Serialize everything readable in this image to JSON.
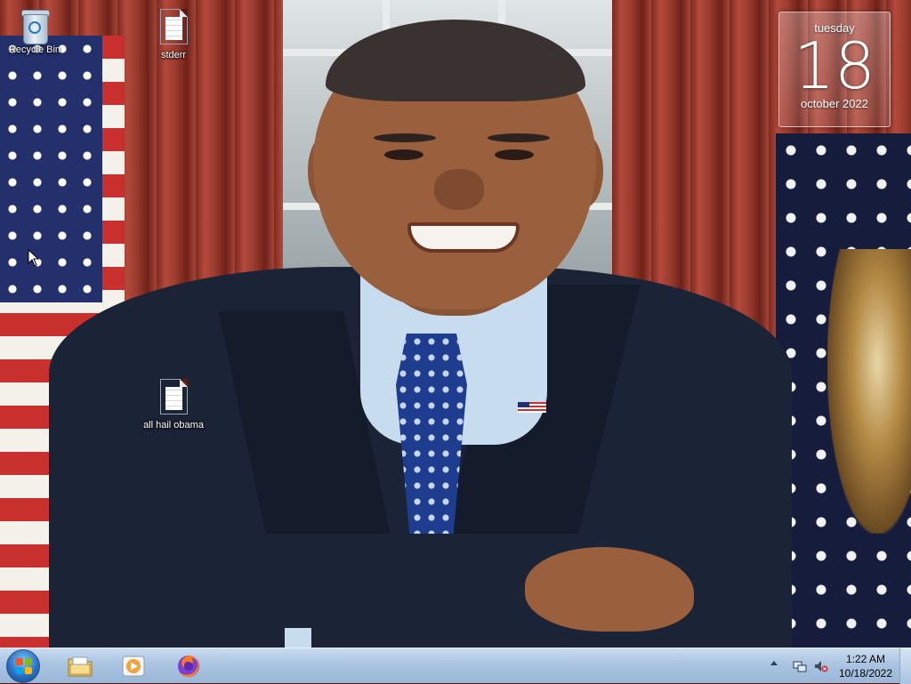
{
  "desktop": {
    "icons": [
      {
        "label": "Recycle Bin",
        "icon": "recycle-bin-icon"
      },
      {
        "label": "stderr",
        "icon": "text-file-icon"
      },
      {
        "label": "all hail obama",
        "icon": "text-file-icon"
      }
    ],
    "wallpaper": "portrait photo wallpaper"
  },
  "gadget": {
    "day": "tuesday",
    "date": "18",
    "month_year": "october 2022"
  },
  "taskbar": {
    "start": "start-orb",
    "pinned": [
      {
        "name": "windows-explorer",
        "icon": "folder-icon"
      },
      {
        "name": "windows-media-player",
        "icon": "media-player-icon"
      },
      {
        "name": "firefox",
        "icon": "firefox-icon"
      }
    ],
    "tray": {
      "icons": [
        "show-hidden-icons-arrow",
        "network-icon",
        "volume-muted-icon"
      ]
    },
    "clock": {
      "time": "1:22 AM",
      "date": "10/18/2022"
    }
  },
  "colors": {
    "taskbar": "#aac4e2",
    "start_orb": "#2a72c4",
    "curtain": "#9a3a2e"
  }
}
